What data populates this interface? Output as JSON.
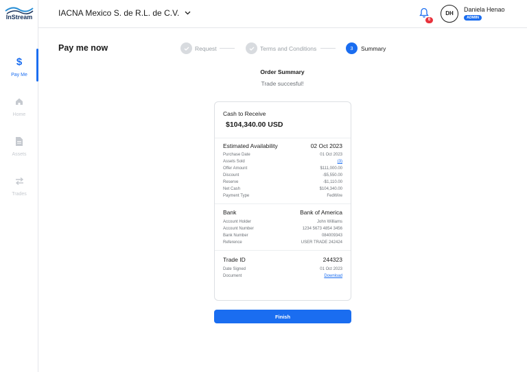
{
  "app": {
    "logo_text": "InStream"
  },
  "sidebar": {
    "items": [
      {
        "label": "Pay Me",
        "icon": "dollar-icon"
      },
      {
        "label": "Home",
        "icon": "home-icon"
      },
      {
        "label": "Assets",
        "icon": "document-icon"
      },
      {
        "label": "Trades",
        "icon": "transfer-icon"
      }
    ]
  },
  "header": {
    "company": "IACNA Mexico S. de R.L. de C.V.",
    "notifications_count": "6",
    "user_initials": "DH",
    "user_name": "Daniela Henao",
    "user_role": "ADMIN"
  },
  "page": {
    "title": "Pay me now",
    "steps": [
      {
        "label": "Request",
        "status": "done"
      },
      {
        "label": "Terms and Conditions",
        "status": "done"
      },
      {
        "label": "Summary",
        "status": "current",
        "number": "3"
      }
    ],
    "summary_title": "Order Summary",
    "summary_subtitle": "Trade succesful!"
  },
  "card": {
    "cash_label": "Cash to Receive",
    "cash_value": "$104,340.00 USD",
    "availability": {
      "label": "Estimated Availability",
      "value": "02 Oct 2023",
      "rows": [
        {
          "k": "Purchase Date",
          "v": "01 Oct 2023"
        },
        {
          "k": "Assets Sold",
          "v": "(3)"
        },
        {
          "k": "Offer Amount",
          "v": "$111,000.00"
        },
        {
          "k": "Discount",
          "v": "-$5,550.00"
        },
        {
          "k": "Reserve",
          "v": "-$1,110.00"
        },
        {
          "k": "Net Cash",
          "v": "$104,340.00"
        },
        {
          "k": "Payment Type",
          "v": "FedWire"
        }
      ]
    },
    "bank": {
      "label": "Bank",
      "value": "Bank of America",
      "rows": [
        {
          "k": "Account Holder",
          "v": "John Williams"
        },
        {
          "k": "Account Number",
          "v": "1234 5673 4854 3456"
        },
        {
          "k": "Bank Number",
          "v": "084009343"
        },
        {
          "k": "Reference",
          "v": "USER TRADE 242424"
        }
      ]
    },
    "trade": {
      "label": "Trade ID",
      "value": "244323",
      "rows": [
        {
          "k": "Date Signed",
          "v": "01 Oct 2023"
        },
        {
          "k": "Document",
          "v": "Download"
        }
      ]
    }
  },
  "actions": {
    "finish_label": "Finish"
  },
  "colors": {
    "accent": "#1a6df0",
    "badge": "#e8323c",
    "logo": "#16315b"
  }
}
